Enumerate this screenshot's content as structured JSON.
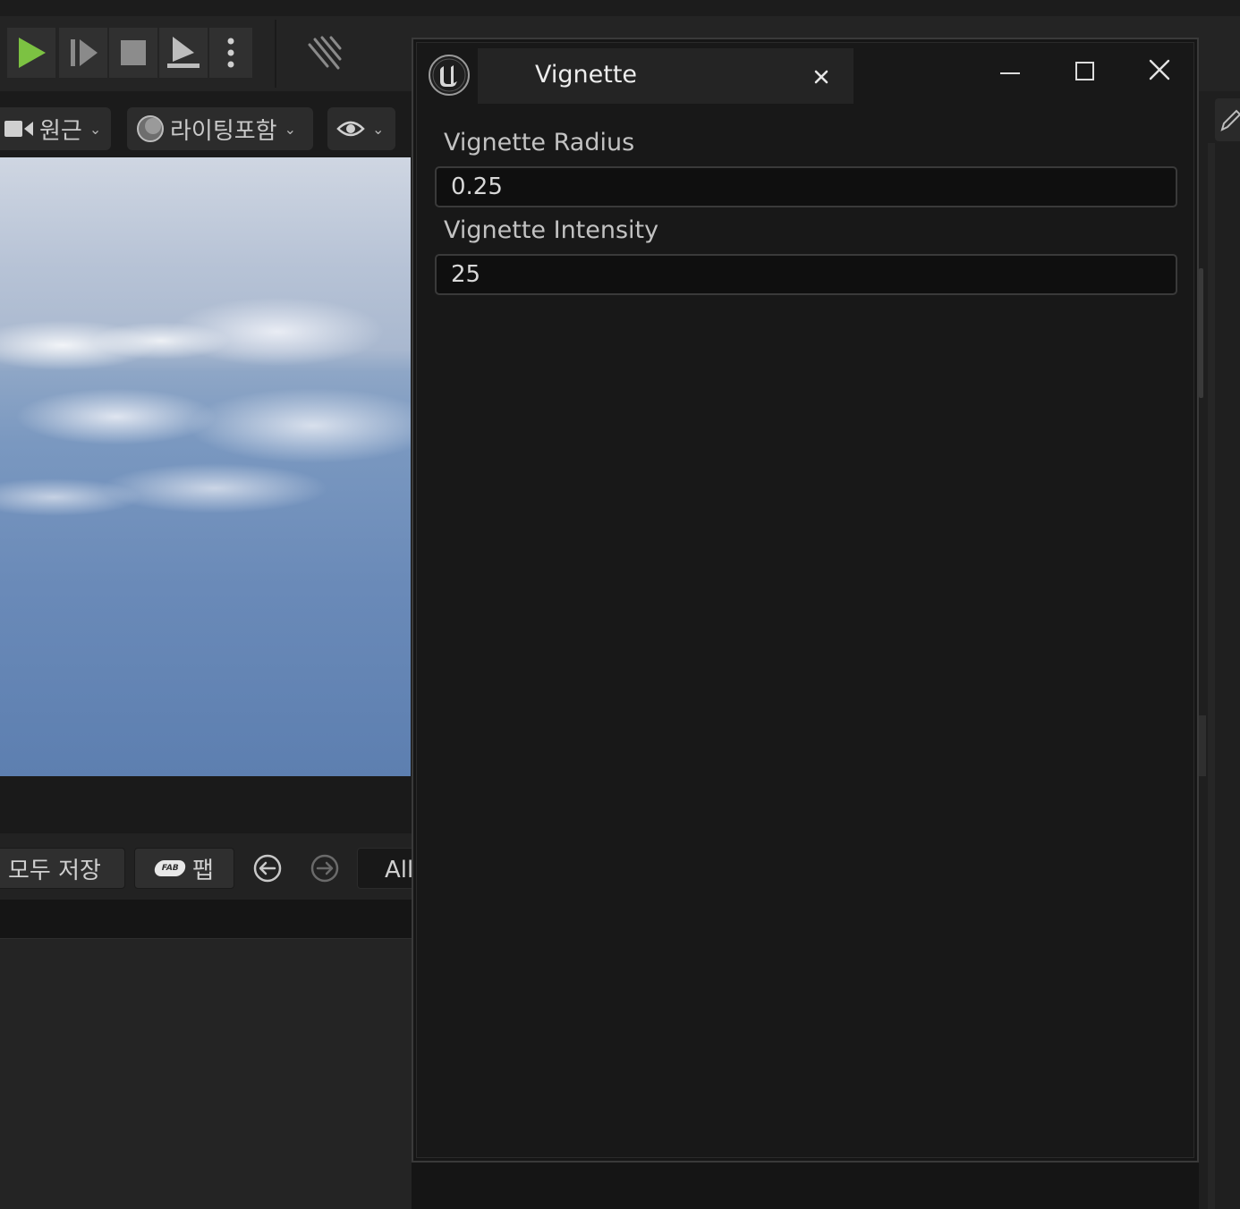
{
  "toolbar": {
    "play_color": "#7cc242"
  },
  "viewport_bar": {
    "view_mode_label": "원근",
    "lighting_label": "라이팅포함"
  },
  "content_browser": {
    "save_all_label": "모두 저장",
    "fab_logo_text": "FAB",
    "fab_label": "팹",
    "filter_text": "All"
  },
  "window": {
    "tab_title": "Vignette",
    "fields": [
      {
        "label": "Vignette Radius",
        "value": "0.25"
      },
      {
        "label": "Vignette Intensity",
        "value": "25"
      }
    ]
  },
  "colors": {
    "accent_green": "#7cc242",
    "window_bg": "#181818",
    "input_bg": "#0f0f0f"
  }
}
